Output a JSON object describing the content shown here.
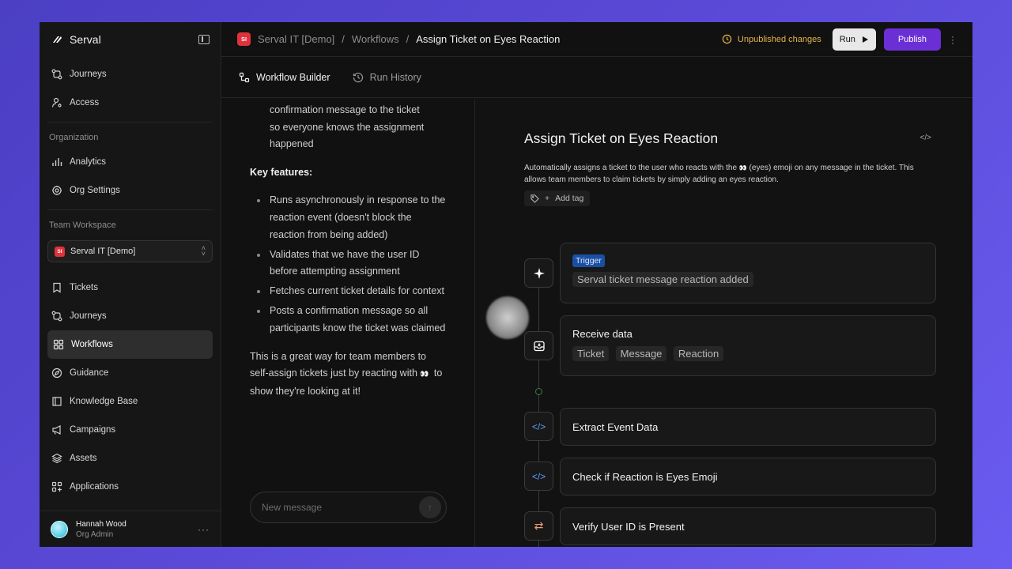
{
  "brand": {
    "name": "Serval"
  },
  "sidebar": {
    "top_items": [
      {
        "label": "Journeys",
        "icon": "journeys-icon"
      },
      {
        "label": "Access",
        "icon": "access-icon"
      }
    ],
    "org_section": "Organization",
    "org_items": [
      {
        "label": "Analytics",
        "icon": "analytics-icon"
      },
      {
        "label": "Org Settings",
        "icon": "gear-icon"
      }
    ],
    "team_section": "Team Workspace",
    "workspace": {
      "badge": "SI",
      "name": "Serval IT [Demo]"
    },
    "team_items": [
      {
        "label": "Tickets",
        "icon": "bookmark-icon"
      },
      {
        "label": "Journeys",
        "icon": "journeys-icon"
      },
      {
        "label": "Workflows",
        "icon": "workflows-icon",
        "active": true
      },
      {
        "label": "Guidance",
        "icon": "compass-icon"
      },
      {
        "label": "Knowledge Base",
        "icon": "book-icon"
      },
      {
        "label": "Campaigns",
        "icon": "megaphone-icon"
      },
      {
        "label": "Assets",
        "icon": "layers-icon"
      },
      {
        "label": "Applications",
        "icon": "apps-icon"
      }
    ],
    "user": {
      "name": "Hannah Wood",
      "role": "Org Admin"
    }
  },
  "header": {
    "breadcrumb": {
      "badge": "SI",
      "workspace": "Serval IT [Demo]",
      "section": "Workflows",
      "current": "Assign Ticket on Eyes Reaction",
      "sep": "/"
    },
    "unpublished": "Unpublished changes",
    "run_label": "Run",
    "publish_label": "Publish"
  },
  "tabs": [
    {
      "label": "Workflow Builder",
      "active": true
    },
    {
      "label": "Run History",
      "active": false
    }
  ],
  "chat": {
    "intro_lines": [
      "confirmation message to the ticket",
      "so everyone knows the assignment",
      "happened"
    ],
    "key_title": "Key features:",
    "features": [
      "Runs asynchronously in response to the reaction event (doesn't block the reaction from being added)",
      "Validates that we have the user ID before attempting assignment",
      "Fetches current ticket details for context",
      "Posts a confirmation message so all participants know the ticket was claimed"
    ],
    "closing": "This is a great way for team members to self-assign tickets just by reacting with",
    "closing_emoji": "👀",
    "closing_end": "to show they're looking at it!",
    "composer_placeholder": "New message"
  },
  "workflow": {
    "title": "Assign Ticket on Eyes Reaction",
    "description_pre": "Automatically assigns a ticket to the user who reacts with the",
    "description_emoji": "👀",
    "description_post": "(eyes) emoji on any message in the ticket. This allows team members to claim tickets by simply adding an eyes reaction.",
    "add_tag": "Add tag",
    "trigger": {
      "pill": "Trigger",
      "value": "Serval ticket message reaction added"
    },
    "receive": {
      "title": "Receive data",
      "chips": [
        "Ticket",
        "Message",
        "Reaction"
      ]
    },
    "steps": [
      {
        "title": "Extract Event Data",
        "icon": "code-icon"
      },
      {
        "title": "Check if Reaction is Eyes Emoji",
        "icon": "code-icon"
      },
      {
        "title": "Verify User ID is Present",
        "icon": "swap-icon"
      }
    ]
  },
  "colors": {
    "accent": "#6b2fd6",
    "warning": "#e6b34a",
    "trigger": "#1b4fa3",
    "badge": "#e0323c"
  }
}
